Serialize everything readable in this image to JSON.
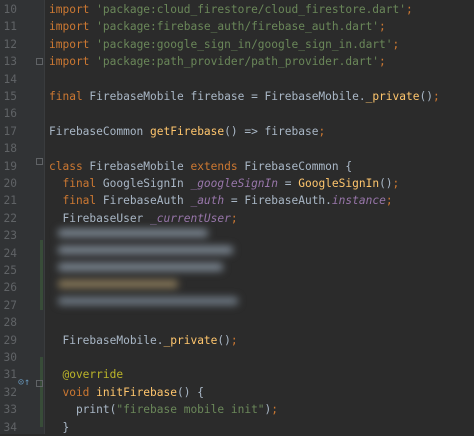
{
  "lines": [
    {
      "no": "10",
      "parts": [
        {
          "t": "import ",
          "c": "kw"
        },
        {
          "t": "'package:cloud_firestore/cloud_firestore.dart'",
          "c": "str"
        },
        {
          "t": ";",
          "c": "kw"
        }
      ]
    },
    {
      "no": "11",
      "parts": [
        {
          "t": "import ",
          "c": "kw"
        },
        {
          "t": "'package:firebase_auth/firebase_auth.dart'",
          "c": "str"
        },
        {
          "t": ";",
          "c": "kw"
        }
      ]
    },
    {
      "no": "12",
      "parts": [
        {
          "t": "import ",
          "c": "kw"
        },
        {
          "t": "'package:google_sign_in/google_sign_in.dart'",
          "c": "str"
        },
        {
          "t": ";",
          "c": "kw"
        }
      ]
    },
    {
      "no": "13",
      "parts": [
        {
          "t": "import ",
          "c": "kw"
        },
        {
          "t": "'package:path_provider/path_provider.dart'",
          "c": "str"
        },
        {
          "t": ";",
          "c": "kw"
        }
      ]
    },
    {
      "no": "14",
      "parts": []
    },
    {
      "no": "15",
      "parts": [
        {
          "t": "final ",
          "c": "kw"
        },
        {
          "t": "FirebaseMobile firebase = FirebaseMobile.",
          "c": ""
        },
        {
          "t": "_private",
          "c": "fn"
        },
        {
          "t": "()",
          "c": ""
        },
        {
          "t": ";",
          "c": "kw"
        }
      ]
    },
    {
      "no": "16",
      "parts": []
    },
    {
      "no": "17",
      "parts": [
        {
          "t": "FirebaseCommon ",
          "c": ""
        },
        {
          "t": "getFirebase",
          "c": "fn"
        },
        {
          "t": "() => firebase",
          "c": ""
        },
        {
          "t": ";",
          "c": "kw"
        }
      ]
    },
    {
      "no": "18",
      "parts": []
    },
    {
      "no": "19",
      "parts": [
        {
          "t": "class ",
          "c": "kw"
        },
        {
          "t": "FirebaseMobile ",
          "c": ""
        },
        {
          "t": "extends ",
          "c": "kw"
        },
        {
          "t": "FirebaseCommon {",
          "c": ""
        }
      ]
    },
    {
      "no": "20",
      "parts": [
        {
          "t": "  final ",
          "c": "kw"
        },
        {
          "t": "GoogleSignIn ",
          "c": ""
        },
        {
          "t": "_googleSignIn",
          "c": "it"
        },
        {
          "t": " = ",
          "c": ""
        },
        {
          "t": "GoogleSignIn",
          "c": "fn"
        },
        {
          "t": "()",
          "c": ""
        },
        {
          "t": ";",
          "c": "kw"
        }
      ]
    },
    {
      "no": "21",
      "parts": [
        {
          "t": "  final ",
          "c": "kw"
        },
        {
          "t": "FirebaseAuth ",
          "c": ""
        },
        {
          "t": "_auth",
          "c": "it"
        },
        {
          "t": " = FirebaseAuth.",
          "c": ""
        },
        {
          "t": "instance",
          "c": "it"
        },
        {
          "t": ";",
          "c": "kw"
        }
      ]
    },
    {
      "no": "22",
      "parts": [
        {
          "t": "  FirebaseUser ",
          "c": ""
        },
        {
          "t": "_currentUser",
          "c": "it"
        },
        {
          "t": ";",
          "c": "kw"
        }
      ]
    },
    {
      "no": "23",
      "parts": []
    },
    {
      "no": "24",
      "parts": []
    },
    {
      "no": "25",
      "parts": []
    },
    {
      "no": "26",
      "parts": []
    },
    {
      "no": "27",
      "parts": []
    },
    {
      "no": "28",
      "parts": []
    },
    {
      "no": "29",
      "parts": [
        {
          "t": "  FirebaseMobile.",
          "c": ""
        },
        {
          "t": "_private",
          "c": "fn"
        },
        {
          "t": "()",
          "c": ""
        },
        {
          "t": ";",
          "c": "kw"
        }
      ]
    },
    {
      "no": "30",
      "parts": []
    },
    {
      "no": "31",
      "parts": [
        {
          "t": "  @override",
          "c": "ann"
        }
      ]
    },
    {
      "no": "32",
      "parts": [
        {
          "t": "  void ",
          "c": "kw"
        },
        {
          "t": "initFirebase",
          "c": "fn"
        },
        {
          "t": "() {",
          "c": ""
        }
      ]
    },
    {
      "no": "33",
      "parts": [
        {
          "t": "    print(",
          "c": ""
        },
        {
          "t": "\"firebase mobile init\"",
          "c": "str"
        },
        {
          "t": ")",
          "c": ""
        },
        {
          "t": ";",
          "c": "kw"
        }
      ]
    },
    {
      "no": "34",
      "parts": [
        {
          "t": "  }",
          "c": ""
        }
      ]
    }
  ],
  "colors": {
    "background": "#2b2b2b",
    "gutter": "#313335",
    "keyword": "#cc7832",
    "string": "#6a8759",
    "function": "#ffc66d",
    "field": "#9876aa",
    "annotation": "#bbb529",
    "default": "#a9b7c6"
  },
  "icons": {
    "override_marker": "override-gutter-icon",
    "fold_markers": "fold-marker-icon"
  }
}
